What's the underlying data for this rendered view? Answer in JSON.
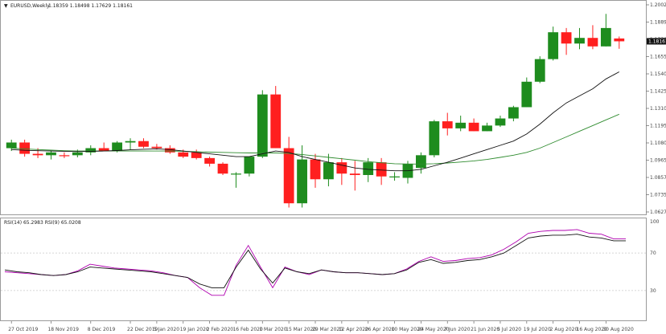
{
  "header": {
    "symbol": "EURUSD,Weekly",
    "ohlc": "1.18359 1.18498 1.17629 1.18161"
  },
  "indicator": {
    "label": "RSI(14) 65.2983 RSI(9) 65.0208"
  },
  "colors": {
    "bull": "#1e8c1e",
    "bear": "#ff1f1f",
    "ma_fast": "#111111",
    "ma_slow": "#2e8b2e",
    "rsi14": "#111111",
    "rsi9": "#b000b0",
    "grid": "#c8c8c8",
    "current_price_box": "#111111"
  },
  "chart_data": [
    {
      "type": "candlestick",
      "price_axis": {
        "ylim": [
          1.062,
          1.204
        ],
        "ticks": [
          "1.20025",
          "1.18890",
          "1.17700",
          "1.16550",
          "1.15400",
          "1.14250",
          "1.13100",
          "1.11950",
          "1.10800",
          "1.09650",
          "1.08575",
          "1.07350",
          "1.06275"
        ],
        "current_price": "1.18161"
      },
      "x_labels": [
        {
          "i": 0,
          "text": "27 Oct 2019"
        },
        {
          "i": 3,
          "text": "18 Nov 2019"
        },
        {
          "i": 6,
          "text": "8 Dec 2019"
        },
        {
          "i": 9,
          "text": "22 Dec 2019"
        },
        {
          "i": 11,
          "text": "5 Jan 2020"
        },
        {
          "i": 13,
          "text": "19 Jan 2020"
        },
        {
          "i": 15,
          "text": "2 Feb 2020"
        },
        {
          "i": 17,
          "text": "16 Feb 2020"
        },
        {
          "i": 19,
          "text": "1 Mar 2020"
        },
        {
          "i": 21,
          "text": "15 Mar 2020"
        },
        {
          "i": 23,
          "text": "29 Mar 2020"
        },
        {
          "i": 25,
          "text": "12 Apr 2020"
        },
        {
          "i": 27,
          "text": "26 Apr 2020"
        },
        {
          "i": 29,
          "text": "10 May 2020"
        },
        {
          "i": 31,
          "text": "24 May 2020"
        },
        {
          "i": 33,
          "text": "7 Jun 2020"
        },
        {
          "i": 35,
          "text": "21 Jun 2020"
        },
        {
          "i": 37,
          "text": "5 Jul 2020"
        },
        {
          "i": 39,
          "text": "19 Jul 2020"
        },
        {
          "i": 41,
          "text": "2 Aug 2020"
        },
        {
          "i": 43,
          "text": "16 Aug 2020"
        },
        {
          "i": 45,
          "text": "30 Aug 2020"
        }
      ],
      "candles": [
        {
          "o": 1.106,
          "h": 1.112,
          "l": 1.104,
          "c": 1.11
        },
        {
          "o": 1.11,
          "h": 1.112,
          "l": 1.1,
          "c": 1.102
        },
        {
          "o": 1.102,
          "h": 1.106,
          "l": 1.099,
          "c": 1.101
        },
        {
          "o": 1.101,
          "h": 1.104,
          "l": 1.098,
          "c": 1.103
        },
        {
          "o": 1.101,
          "h": 1.103,
          "l": 1.099,
          "c": 1.1005
        },
        {
          "o": 1.101,
          "h": 1.105,
          "l": 1.0995,
          "c": 1.103
        },
        {
          "o": 1.103,
          "h": 1.108,
          "l": 1.101,
          "c": 1.106
        },
        {
          "o": 1.106,
          "h": 1.11,
          "l": 1.104,
          "c": 1.104
        },
        {
          "o": 1.104,
          "h": 1.111,
          "l": 1.103,
          "c": 1.11
        },
        {
          "o": 1.11,
          "h": 1.113,
          "l": 1.105,
          "c": 1.111
        },
        {
          "o": 1.111,
          "h": 1.113,
          "l": 1.106,
          "c": 1.107
        },
        {
          "o": 1.107,
          "h": 1.109,
          "l": 1.105,
          "c": 1.106
        },
        {
          "o": 1.106,
          "h": 1.108,
          "l": 1.102,
          "c": 1.103
        },
        {
          "o": 1.103,
          "h": 1.105,
          "l": 1.099,
          "c": 1.1
        },
        {
          "o": 1.103,
          "h": 1.105,
          "l": 1.098,
          "c": 1.099
        },
        {
          "o": 1.099,
          "h": 1.1,
          "l": 1.093,
          "c": 1.095
        },
        {
          "o": 1.095,
          "h": 1.096,
          "l": 1.087,
          "c": 1.088
        },
        {
          "o": 1.088,
          "h": 1.089,
          "l": 1.078,
          "c": 1.088
        },
        {
          "o": 1.088,
          "h": 1.099,
          "l": 1.086,
          "c": 1.1
        },
        {
          "o": 1.1,
          "h": 1.147,
          "l": 1.099,
          "c": 1.144
        },
        {
          "o": 1.144,
          "h": 1.15,
          "l": 1.106,
          "c": 1.106
        },
        {
          "o": 1.106,
          "h": 1.114,
          "l": 1.064,
          "c": 1.067
        },
        {
          "o": 1.067,
          "h": 1.108,
          "l": 1.064,
          "c": 1.098
        },
        {
          "o": 1.098,
          "h": 1.102,
          "l": 1.078,
          "c": 1.084
        },
        {
          "o": 1.084,
          "h": 1.102,
          "l": 1.079,
          "c": 1.096
        },
        {
          "o": 1.096,
          "h": 1.099,
          "l": 1.08,
          "c": 1.088
        },
        {
          "o": 1.088,
          "h": 1.097,
          "l": 1.076,
          "c": 1.087
        },
        {
          "o": 1.087,
          "h": 1.099,
          "l": 1.082,
          "c": 1.096
        },
        {
          "o": 1.096,
          "h": 1.099,
          "l": 1.08,
          "c": 1.086
        },
        {
          "o": 1.086,
          "h": 1.089,
          "l": 1.083,
          "c": 1.086
        },
        {
          "o": 1.085,
          "h": 1.097,
          "l": 1.081,
          "c": 1.095
        },
        {
          "o": 1.092,
          "h": 1.103,
          "l": 1.088,
          "c": 1.101
        },
        {
          "o": 1.101,
          "h": 1.126,
          "l": 1.0995,
          "c": 1.125
        },
        {
          "o": 1.125,
          "h": 1.131,
          "l": 1.115,
          "c": 1.12
        },
        {
          "o": 1.12,
          "h": 1.129,
          "l": 1.118,
          "c": 1.124
        },
        {
          "o": 1.124,
          "h": 1.127,
          "l": 1.118,
          "c": 1.118
        },
        {
          "o": 1.118,
          "h": 1.124,
          "l": 1.118,
          "c": 1.122
        },
        {
          "o": 1.122,
          "h": 1.129,
          "l": 1.121,
          "c": 1.127
        },
        {
          "o": 1.127,
          "h": 1.136,
          "l": 1.125,
          "c": 1.135
        },
        {
          "o": 1.135,
          "h": 1.156,
          "l": 1.135,
          "c": 1.153
        },
        {
          "o": 1.153,
          "h": 1.171,
          "l": 1.152,
          "c": 1.169
        },
        {
          "o": 1.169,
          "h": 1.192,
          "l": 1.168,
          "c": 1.188
        },
        {
          "o": 1.188,
          "h": 1.191,
          "l": 1.172,
          "c": 1.18
        },
        {
          "o": 1.18,
          "h": 1.191,
          "l": 1.176,
          "c": 1.184
        },
        {
          "o": 1.184,
          "h": 1.193,
          "l": 1.176,
          "c": 1.178
        },
        {
          "o": 1.178,
          "h": 1.201,
          "l": 1.178,
          "c": 1.191
        },
        {
          "o": 1.1836,
          "h": 1.185,
          "l": 1.1763,
          "c": 1.1816
        }
      ],
      "ma_fast": [
        1.105,
        1.1045,
        1.1042,
        1.104,
        1.1038,
        1.1036,
        1.1038,
        1.104,
        1.1043,
        1.1048,
        1.1052,
        1.1055,
        1.105,
        1.104,
        1.103,
        1.102,
        1.101,
        1.1,
        1.1,
        1.102,
        1.104,
        1.103,
        1.1,
        1.098,
        1.096,
        1.094,
        1.092,
        1.091,
        1.0905,
        1.09,
        1.09,
        1.091,
        1.0935,
        1.096,
        1.099,
        1.102,
        1.105,
        1.108,
        1.111,
        1.116,
        1.123,
        1.131,
        1.138,
        1.143,
        1.148,
        1.155,
        1.16
      ],
      "ma_slow": [
        1.106,
        1.1055,
        1.105,
        1.1046,
        1.1042,
        1.104,
        1.104,
        1.104,
        1.104,
        1.104,
        1.104,
        1.104,
        1.104,
        1.1038,
        1.1035,
        1.1032,
        1.103,
        1.1028,
        1.1026,
        1.1026,
        1.1026,
        1.1022,
        1.1015,
        1.1005,
        1.0995,
        1.0985,
        1.0975,
        1.0965,
        1.0957,
        1.095,
        1.0948,
        1.0948,
        1.095,
        1.0955,
        1.0962,
        1.097,
        1.098,
        1.0995,
        1.101,
        1.103,
        1.106,
        1.11,
        1.114,
        1.118,
        1.122,
        1.126,
        1.13
      ]
    },
    {
      "type": "line",
      "ylim": [
        0,
        100
      ],
      "levels": [
        {
          "value": 70,
          "text": "70"
        },
        {
          "value": 30,
          "text": "30"
        }
      ],
      "top_label": "100",
      "series": [
        {
          "name": "RSI(14)",
          "values": [
            52,
            50,
            49,
            47,
            46,
            47,
            50,
            55,
            54,
            53,
            52,
            51,
            50,
            48,
            46,
            44,
            37,
            33,
            33,
            55,
            73,
            53,
            38,
            54,
            50,
            48,
            52,
            50,
            49,
            49,
            48,
            47,
            48,
            52,
            60,
            63,
            59,
            60,
            62,
            63,
            66,
            70,
            78,
            86,
            88,
            89,
            89,
            90,
            87,
            86,
            83,
            83
          ]
        },
        {
          "name": "RSI(9)",
          "values": [
            50,
            49,
            48,
            47,
            46,
            47,
            51,
            58,
            56,
            54,
            53,
            52,
            51,
            49,
            46,
            44,
            33,
            25,
            25,
            57,
            78,
            55,
            33,
            55,
            50,
            47,
            52,
            50,
            49,
            49,
            48,
            47,
            48,
            53,
            61,
            66,
            61,
            62,
            64,
            65,
            68,
            74,
            82,
            91,
            93,
            94,
            94,
            95,
            91,
            90,
            85,
            85
          ]
        }
      ]
    }
  ]
}
